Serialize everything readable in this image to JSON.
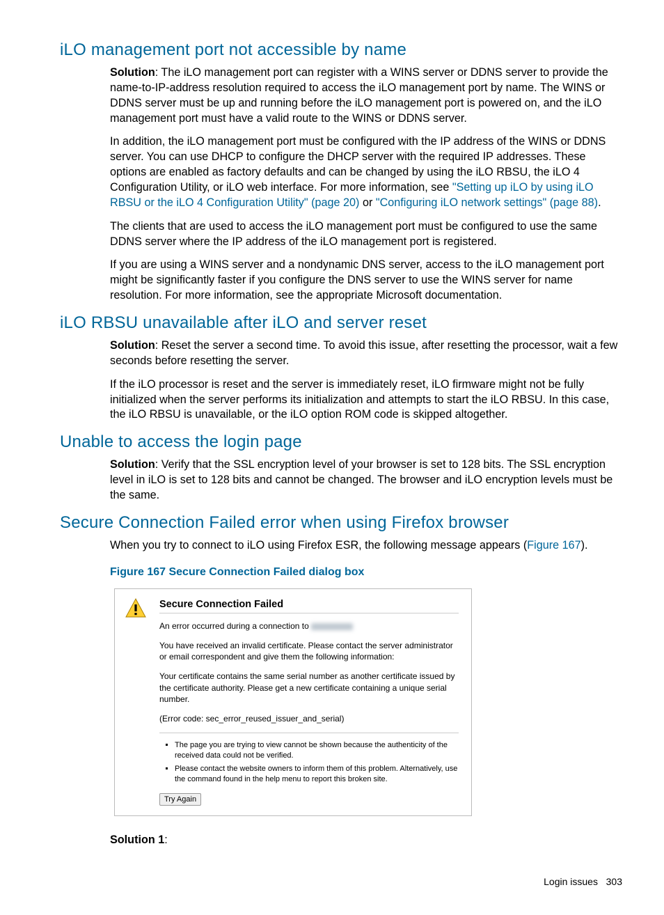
{
  "sections": {
    "s1": {
      "heading": "iLO management port not accessible by name",
      "sol_label": "Solution",
      "p1_after": ": The iLO management port can register with a WINS server or DDNS server to provide the name-to-IP-address resolution required to access the iLO management port by name. The WINS or DDNS server must be up and running before the iLO management port is powered on, and the iLO management port must have a valid route to the WINS or DDNS server.",
      "p2_a": "In addition, the iLO management port must be configured with the IP address of the WINS or DDNS server. You can use DHCP to configure the DHCP server with the required IP addresses. These options are enabled as factory defaults and can be changed by using the iLO RBSU, the iLO 4 Configuration Utility, or iLO web interface. For more information, see ",
      "link1": "\"Setting up iLO by using iLO RBSU or the iLO 4 Configuration Utility\" (page 20)",
      "p2_b": " or ",
      "link2": "\"Configuring iLO network settings\" (page 88)",
      "p2_c": ".",
      "p3": "The clients that are used to access the iLO management port must be configured to use the same DDNS server where the IP address of the iLO management port is registered.",
      "p4": "If you are using a WINS server and a nondynamic DNS server, access to the iLO management port might be significantly faster if you configure the DNS server to use the WINS server for name resolution. For more information, see the appropriate Microsoft documentation."
    },
    "s2": {
      "heading": "iLO RBSU unavailable after iLO and server reset",
      "sol_label": "Solution",
      "p1_after": ": Reset the server a second time. To avoid this issue, after resetting the processor, wait a few seconds before resetting the server.",
      "p2": "If the iLO processor is reset and the server is immediately reset, iLO firmware might not be fully initialized when the server performs its initialization and attempts to start the iLO RBSU. In this case, the iLO RBSU is unavailable, or the iLO option ROM code is skipped altogether."
    },
    "s3": {
      "heading": "Unable to access the login page",
      "sol_label": "Solution",
      "p1_after": ": Verify that the SSL encryption level of your browser is set to 128 bits. The SSL encryption level in iLO is set to 128 bits and cannot be changed. The browser and iLO encryption levels must be the same."
    },
    "s4": {
      "heading": "Secure Connection Failed error when using Firefox browser",
      "p1_a": "When you try to connect to iLO using Firefox ESR, the following message appears (",
      "link1": "Figure 167",
      "p1_b": ").",
      "fig_caption": "Figure 167 Secure Connection Failed dialog box",
      "sol1_label": "Solution 1",
      "sol1_after": ":"
    }
  },
  "dialog": {
    "title": "Secure Connection Failed",
    "line1": "An error occurred during a connection to ",
    "line2": "You have received an invalid certificate.  Please contact the server administrator or email correspondent and give them the following information:",
    "line3": "Your certificate contains the same serial number as another certificate issued by the certificate authority.  Please get a new certificate containing a unique serial number.",
    "line4": "(Error code: sec_error_reused_issuer_and_serial)",
    "bullet1": "The page you are trying to view cannot be shown because the authenticity of the received data could not be verified.",
    "bullet2": "Please contact the website owners to inform them of this problem. Alternatively, use the command found in the help menu to report this broken site.",
    "try_again": "Try Again"
  },
  "footer": {
    "text": "Login issues",
    "page": "303"
  }
}
